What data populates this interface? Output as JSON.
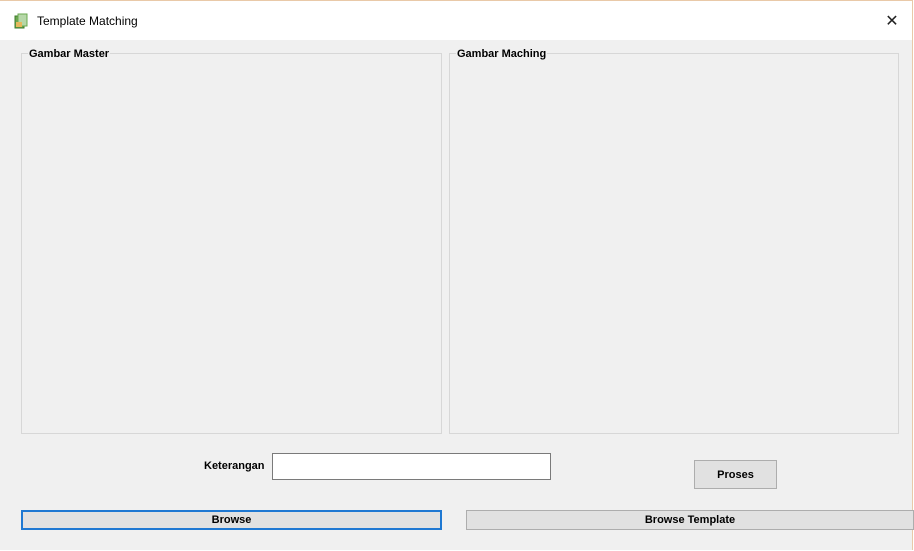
{
  "window": {
    "title": "Template Matching",
    "close_glyph": "✕",
    "app_icon": "app-icon"
  },
  "groups": {
    "master_label": "Gambar Master",
    "maching_label": "Gambar Maching"
  },
  "form": {
    "keterangan_label": "Keterangan",
    "keterangan_value": "",
    "proses_label": "Proses"
  },
  "buttons": {
    "browse_label": "Browse",
    "browse_template_label": "Browse Template"
  },
  "colors": {
    "focus_border": "#1e78d2",
    "window_bg": "#f0f0f0"
  }
}
